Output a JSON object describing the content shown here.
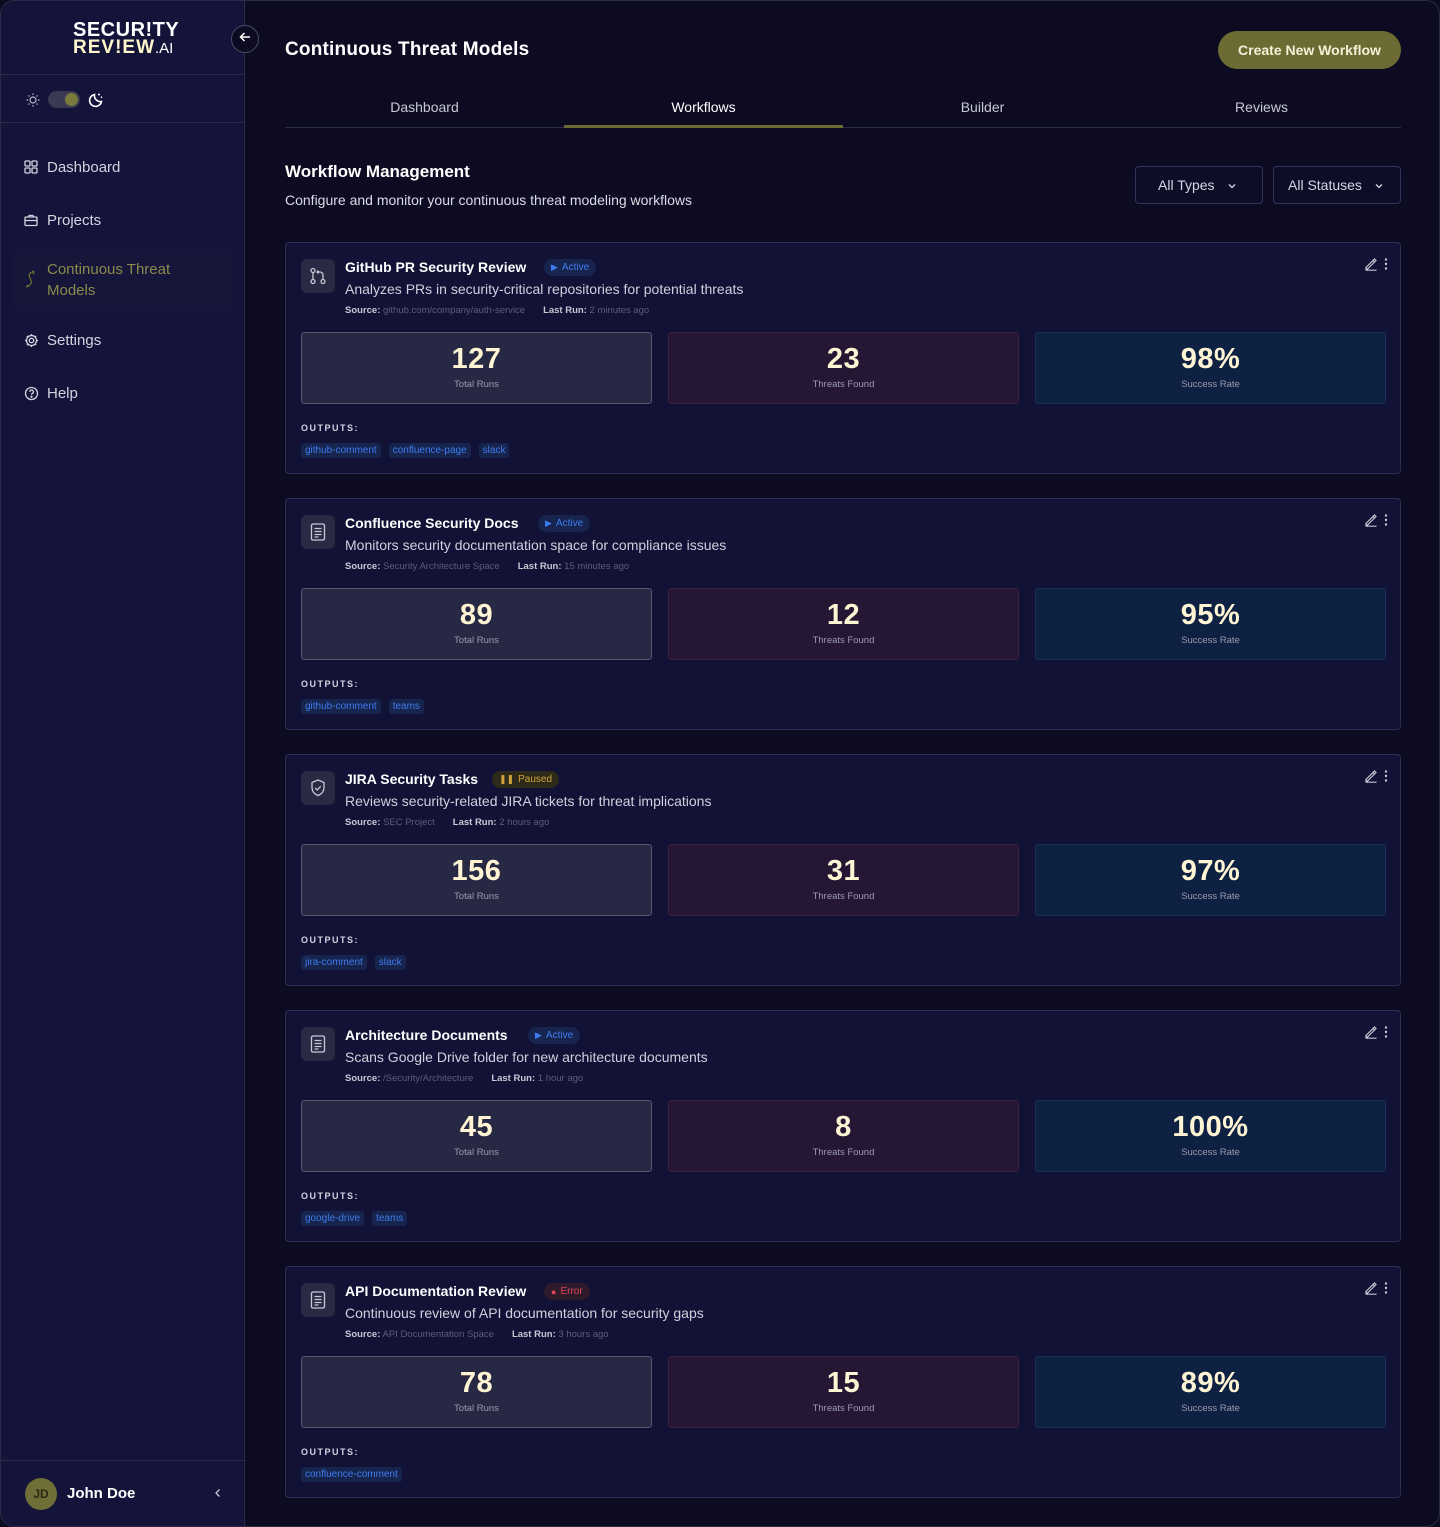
{
  "app": {
    "logo_line1": "SECUR!TY",
    "logo_line2": "REV!EW",
    "logo_suffix": ".AI"
  },
  "sidebar": {
    "items": [
      {
        "label": "Dashboard",
        "icon": "grid-icon"
      },
      {
        "label": "Projects",
        "icon": "briefcase-icon"
      },
      {
        "label": "Continuous Threat Models",
        "icon": "flow-icon",
        "active": true
      },
      {
        "label": "Settings",
        "icon": "gear-icon"
      },
      {
        "label": "Help",
        "icon": "help-icon"
      }
    ],
    "user": {
      "initials": "JD",
      "name": "John Doe"
    }
  },
  "header": {
    "title": "Continuous Threat Models",
    "create_button": "Create New Workflow"
  },
  "tabs": [
    {
      "label": "Dashboard"
    },
    {
      "label": "Workflows",
      "active": true
    },
    {
      "label": "Builder"
    },
    {
      "label": "Reviews"
    }
  ],
  "section": {
    "title": "Workflow Management",
    "subtitle": "Configure and monitor your continuous threat modeling workflows",
    "filter_types": "All Types",
    "filter_statuses": "All Statuses"
  },
  "labels": {
    "source": "Source:",
    "last_run": "Last Run:",
    "total_runs": "Total Runs",
    "threats_found": "Threats Found",
    "success_rate": "Success Rate",
    "outputs": "OUTPUTS:"
  },
  "workflows": [
    {
      "name": "GitHub PR Security Review",
      "status": "Active",
      "icon": "git-pull-request-icon",
      "description": "Analyzes PRs in security-critical repositories for potential threats",
      "source": "github.com/company/auth-service",
      "last_run": "2 minutes ago",
      "total_runs": "127",
      "threats_found": "23",
      "success_rate": "98%",
      "outputs": [
        "github-comment",
        "confluence-page",
        "slack"
      ]
    },
    {
      "name": "Confluence Security Docs",
      "status": "Active",
      "icon": "document-icon",
      "description": "Monitors security documentation space for compliance issues",
      "source": "Security Architecture Space",
      "last_run": "15 minutes ago",
      "total_runs": "89",
      "threats_found": "12",
      "success_rate": "95%",
      "outputs": [
        "github-comment",
        "teams"
      ]
    },
    {
      "name": "JIRA Security Tasks",
      "status": "Paused",
      "icon": "shield-check-icon",
      "description": "Reviews security-related JIRA tickets for threat implications",
      "source": "SEC Project",
      "last_run": "2 hours ago",
      "total_runs": "156",
      "threats_found": "31",
      "success_rate": "97%",
      "outputs": [
        "jira-comment",
        "slack"
      ]
    },
    {
      "name": "Architecture Documents",
      "status": "Active",
      "icon": "document-icon",
      "description": "Scans Google Drive folder for new architecture documents",
      "source": "/Security/Architecture",
      "last_run": "1 hour ago",
      "total_runs": "45",
      "threats_found": "8",
      "success_rate": "100%",
      "outputs": [
        "google-drive",
        "teams"
      ]
    },
    {
      "name": "API Documentation Review",
      "status": "Error",
      "icon": "document-icon",
      "description": "Continuous review of API documentation for security gaps",
      "source": "API Documentation Space",
      "last_run": "3 hours ago",
      "total_runs": "78",
      "threats_found": "15",
      "success_rate": "89%",
      "outputs": [
        "confluence-comment"
      ]
    }
  ],
  "colors": {
    "accent": "#6b6b33",
    "background": "#0c0b22",
    "sidebar": "#14143a",
    "active_badge": "#3d7cf0",
    "paused_badge": "#d4a23a",
    "error_badge": "#e04a5a"
  }
}
